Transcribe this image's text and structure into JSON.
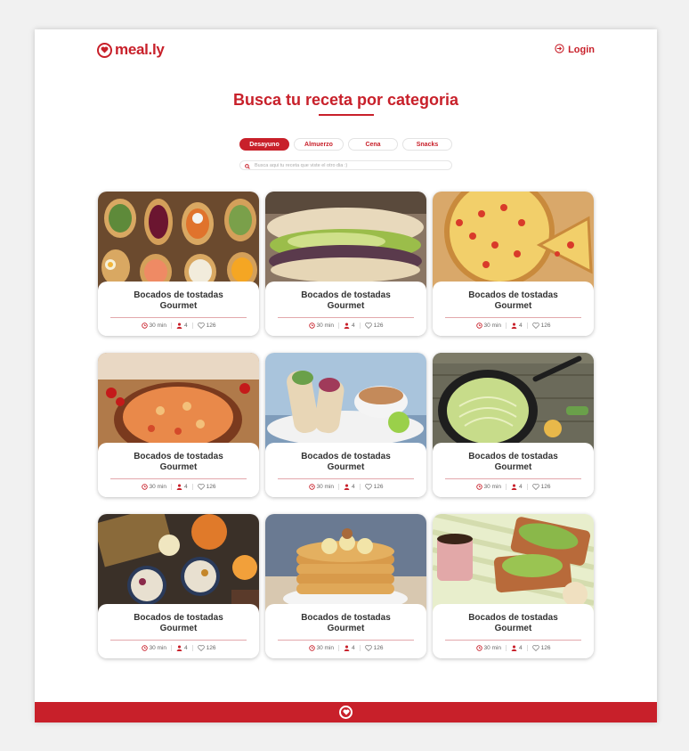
{
  "brand": {
    "name": "meal.ly",
    "color": "#c8202a"
  },
  "header": {
    "login_label": "Login"
  },
  "main": {
    "title": "Busca tu receta por categoria"
  },
  "tabs": [
    {
      "label": "Desayuno",
      "active": true
    },
    {
      "label": "Almuerzo",
      "active": false
    },
    {
      "label": "Cena",
      "active": false
    },
    {
      "label": "Snacks",
      "active": false
    }
  ],
  "search": {
    "placeholder": "Busca aqui tu receta que viste el otro dia :)"
  },
  "cards": [
    {
      "title": "Bocados de tostadas Gourmet",
      "time": "30 min",
      "servings": "4",
      "likes": "126",
      "image": "toast-bites"
    },
    {
      "title": "Bocados de tostadas Gourmet",
      "time": "30 min",
      "servings": "4",
      "likes": "126",
      "image": "avocado-sandwich"
    },
    {
      "title": "Bocados de tostadas Gourmet",
      "time": "30 min",
      "servings": "4",
      "likes": "126",
      "image": "tomato-tart"
    },
    {
      "title": "Bocados de tostadas Gourmet",
      "time": "30 min",
      "servings": "4",
      "likes": "126",
      "image": "paella"
    },
    {
      "title": "Bocados de tostadas Gourmet",
      "time": "30 min",
      "servings": "4",
      "likes": "126",
      "image": "wraps"
    },
    {
      "title": "Bocados de tostadas Gourmet",
      "time": "30 min",
      "servings": "4",
      "likes": "126",
      "image": "zucchini-noodles"
    },
    {
      "title": "Bocados de tostadas Gourmet",
      "time": "30 min",
      "servings": "4",
      "likes": "126",
      "image": "granola-bowls"
    },
    {
      "title": "Bocados de tostadas Gourmet",
      "time": "30 min",
      "servings": "4",
      "likes": "126",
      "image": "pancakes"
    },
    {
      "title": "Bocados de tostadas Gourmet",
      "time": "30 min",
      "servings": "4",
      "likes": "126",
      "image": "avocado-toast"
    }
  ]
}
